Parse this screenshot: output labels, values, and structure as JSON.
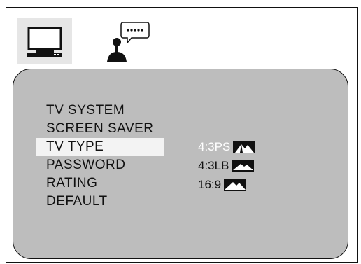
{
  "icons": {
    "tv_tab": "tv-icon",
    "language_tab": "language-speech-icon",
    "aspect_thumb": "mountain-aspect-icon"
  },
  "menu": {
    "items": [
      {
        "label": "TV SYSTEM",
        "selected": false
      },
      {
        "label": "SCREEN  SAVER",
        "selected": false
      },
      {
        "label": "TV TYPE",
        "selected": true
      },
      {
        "label": "PASSWORD",
        "selected": false
      },
      {
        "label": "RATING",
        "selected": false
      },
      {
        "label": "DEFAULT",
        "selected": false
      }
    ]
  },
  "tv_type_options": [
    {
      "label": "4:3PS",
      "active": true
    },
    {
      "label": "4:3LB",
      "active": false
    },
    {
      "label": "16:9",
      "active": false
    }
  ],
  "colors": {
    "panel": "#bdbdbd",
    "selected_row": "#f3f3f3",
    "active_option_text": "#ffffff",
    "text": "#111111"
  }
}
